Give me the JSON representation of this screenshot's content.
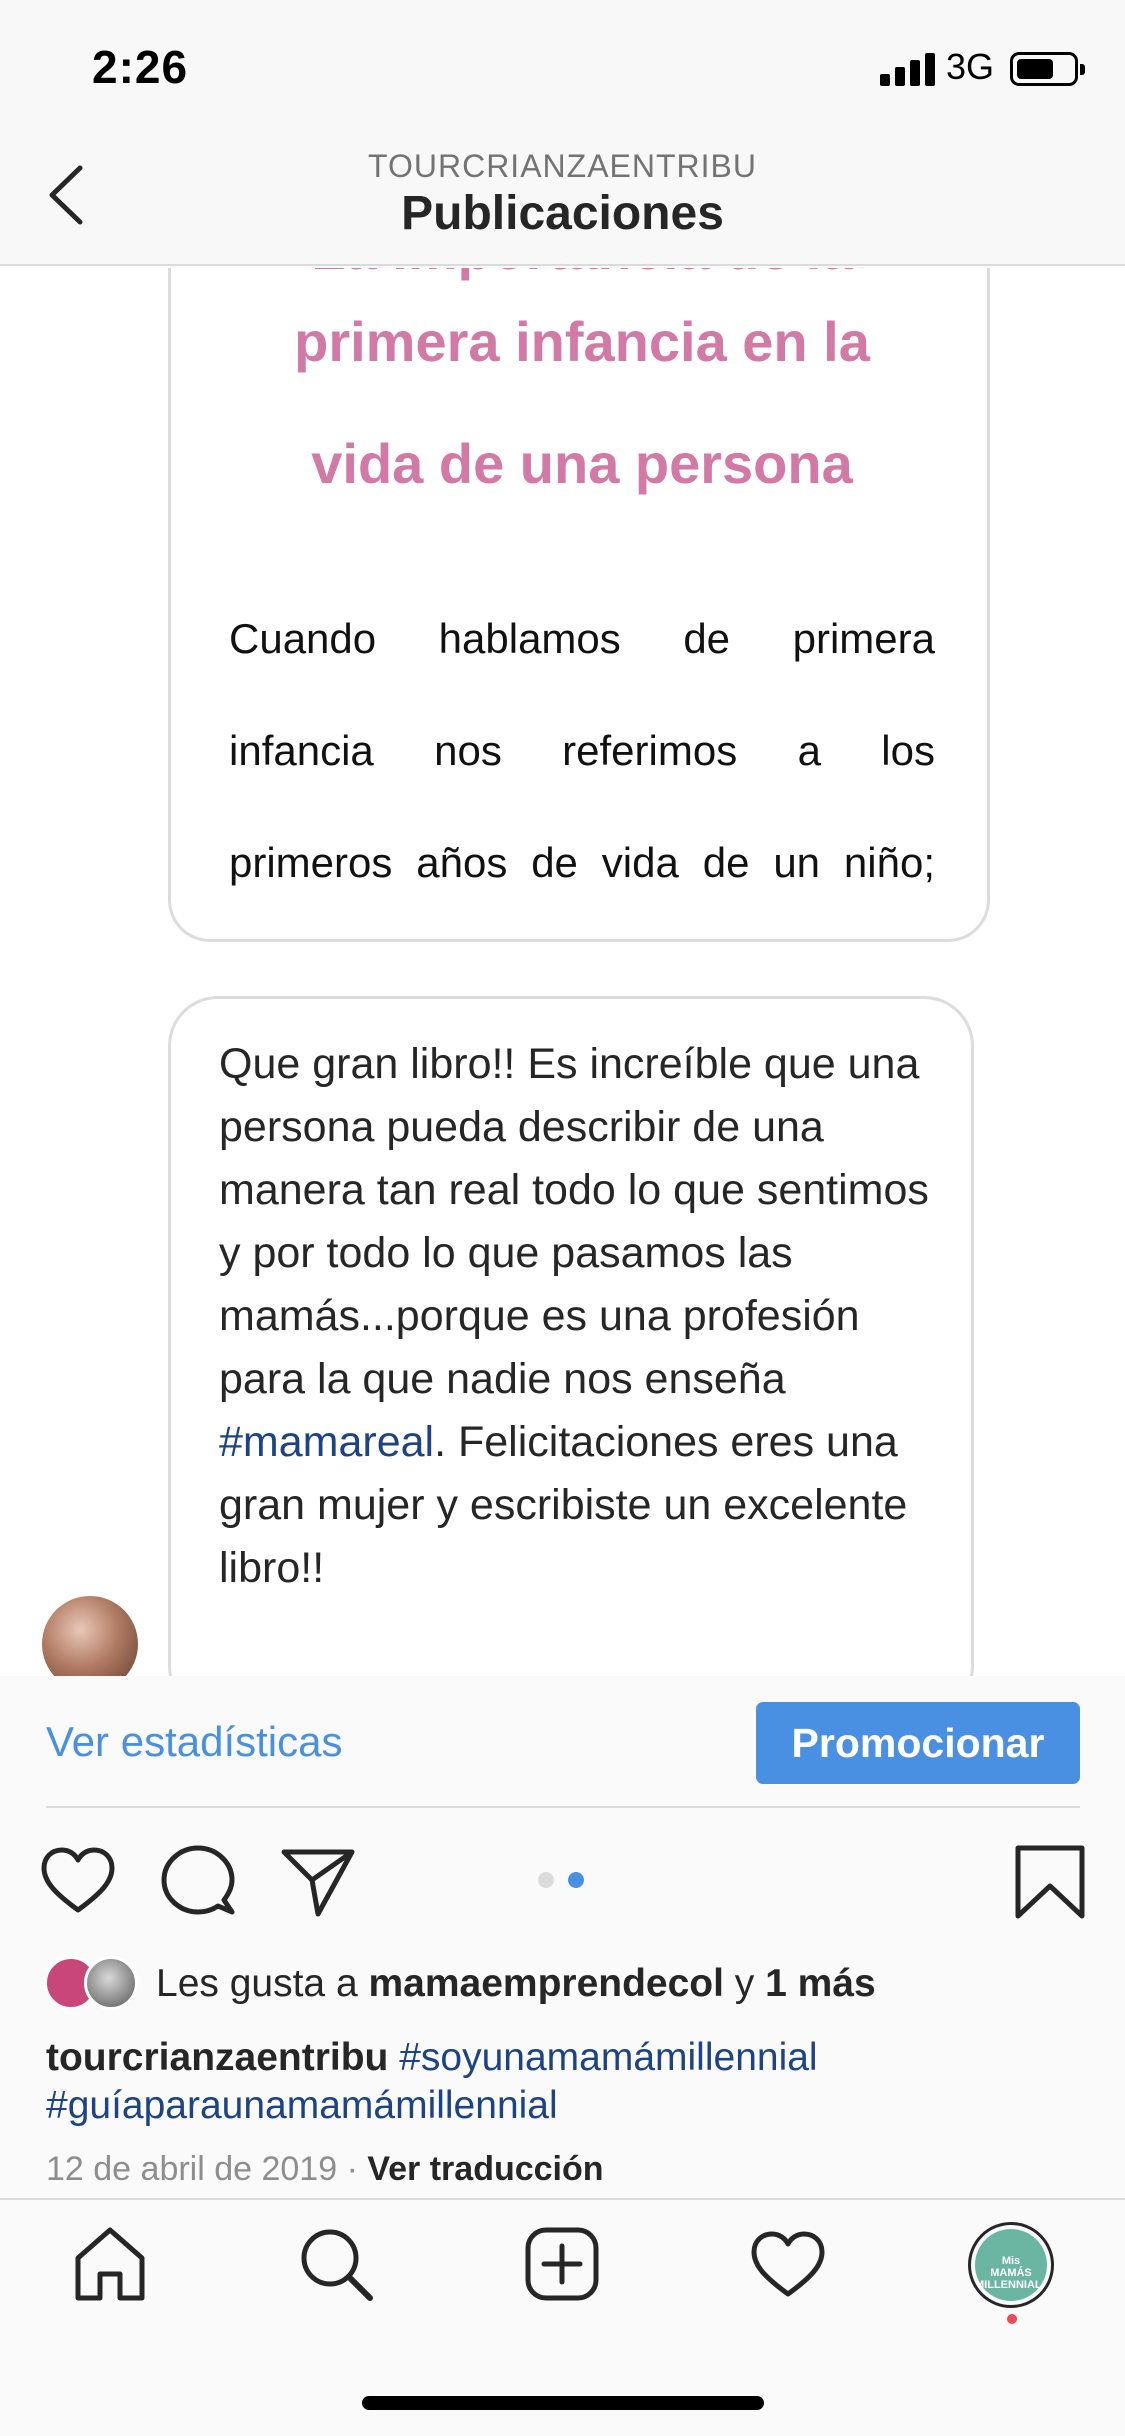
{
  "status_bar": {
    "time": "2:26",
    "network": "3G",
    "icons": [
      "signal-icon",
      "battery-icon"
    ]
  },
  "header": {
    "account": "TOURCRIANZAENTRIBU",
    "title": "Publicaciones",
    "back_icon": "chevron-left-icon"
  },
  "post_image": {
    "card1": {
      "title_lines": [
        "La importancia de la",
        "primera infancia en la",
        "vida de una persona"
      ],
      "body_lines": [
        [
          "Cuando",
          "hablamos",
          "de",
          "primera"
        ],
        [
          "infancia",
          "nos",
          "referimos",
          "a",
          "los"
        ],
        [
          "primeros",
          "años",
          "de",
          "vida",
          "de",
          "un",
          "niño;"
        ]
      ],
      "title_color": "#d279a6"
    },
    "card2": {
      "text_before": "Que gran libro!! Es increíble que una persona pueda describir de una manera tan real todo lo que sentimos y por todo lo que pasamos las mamás...porque es una profesión para la que nadie nos enseña ",
      "hashtag": "#mamareal",
      "text_after": ". Felicitaciones eres una gran mujer y escribiste un excelente libro!!"
    }
  },
  "stats": {
    "link": "Ver estadísticas",
    "promote": "Promocionar",
    "accent_color": "#4a90e2"
  },
  "actions": {
    "icons": [
      "heart-icon",
      "comment-icon",
      "share-icon",
      "bookmark-icon"
    ],
    "carousel": {
      "count": 2,
      "active": 2
    }
  },
  "likes": {
    "prefix": "Les gusta a ",
    "user": "mamaemprendecol",
    "connector": " y ",
    "more": "1 más"
  },
  "caption": {
    "user": "tourcrianzaentribu",
    "tag1": "#soyunamamámillennial",
    "tag2": "#guíaparaunamamámillennial"
  },
  "meta": {
    "date": "12 de abril de 2019",
    "separator": " · ",
    "translate": "Ver traducción"
  },
  "nav": {
    "icons": [
      "home-icon",
      "search-icon",
      "add-post-icon",
      "activity-icon",
      "profile-avatar"
    ],
    "profile_lines": [
      "Mis",
      "MAMÁS",
      "MILLENNIALS"
    ]
  }
}
